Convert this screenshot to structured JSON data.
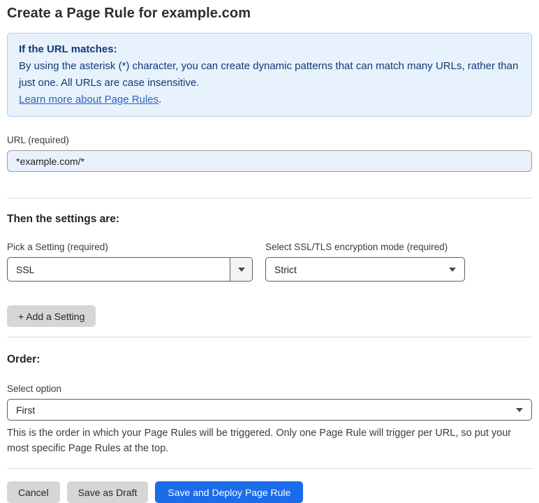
{
  "page": {
    "title": "Create a Page Rule for example.com"
  },
  "info_box": {
    "heading": "If the URL matches:",
    "body": "By using the asterisk (*) character, you can create dynamic patterns that can match many URLs, rather than just one. All URLs are case insensitive.",
    "link_label": "Learn more about Page Rules",
    "link_suffix": "."
  },
  "url_field": {
    "label": "URL (required)",
    "value": "*example.com/*"
  },
  "settings_section": {
    "heading": "Then the settings are:",
    "setting_select": {
      "label": "Pick a Setting (required)",
      "value": "SSL"
    },
    "mode_select": {
      "label": "Select SSL/TLS encryption mode (required)",
      "value": "Strict"
    },
    "add_setting_label": "+ Add a Setting"
  },
  "order_section": {
    "heading": "Order:",
    "select_label": "Select option",
    "select_value": "First",
    "help_text": "This is the order in which your Page Rules will be triggered. Only one Page Rule will trigger per URL, so put your most specific Page Rules at the top."
  },
  "footer": {
    "cancel_label": "Cancel",
    "save_draft_label": "Save as Draft",
    "save_deploy_label": "Save and Deploy Page Rule"
  },
  "colors": {
    "accent_blue": "#1a6ce8",
    "info_bg": "#e8f2fc",
    "info_border": "#abcdf2",
    "info_text": "#0d3b74",
    "link_blue": "#2e63bd",
    "input_bg": "#e9f1fd",
    "divider_gray": "#d9d9d9",
    "button_gray": "#d6d6d6"
  }
}
